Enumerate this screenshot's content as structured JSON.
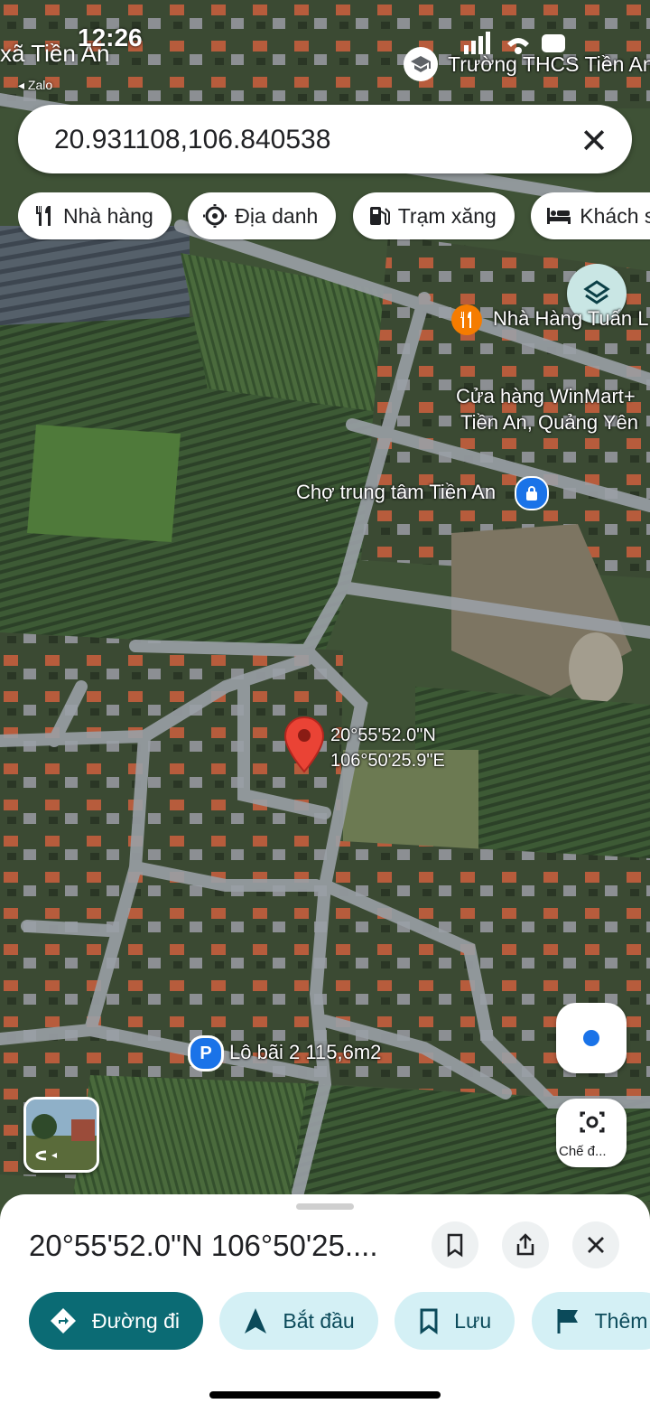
{
  "status_bar": {
    "time": "12:26",
    "back_app_label": "xã Tiền An",
    "back_app_name": "Zalo"
  },
  "search": {
    "query": "20.931108,106.840538"
  },
  "chips": [
    {
      "icon": "fork-knife-icon",
      "label": "Nhà hàng"
    },
    {
      "icon": "landmark-icon",
      "label": "Địa danh"
    },
    {
      "icon": "gas-pump-icon",
      "label": "Trạm xăng"
    },
    {
      "icon": "bed-icon",
      "label": "Khách sạn"
    }
  ],
  "map": {
    "labels": {
      "school": "Trường THCS Tiền An",
      "restaurant": "Nhà Hàng Tuấn L",
      "store_line1": "Cửa hàng WinMart+",
      "store_line2": "Tiền An, Quảng Yên",
      "market": "Chợ trung tâm Tiền An",
      "parking": "Lô bãi 2 115,6m2"
    },
    "pin": {
      "lat_text": "20°55'52.0\"N",
      "lng_text": "106°50'25.9\"E",
      "color": "#ea4335"
    },
    "camera_label": "Chế đ..."
  },
  "sheet": {
    "title": "20°55'52.0\"N 106°50'25....",
    "actions": [
      {
        "icon": "directions-icon",
        "label": "Đường đi"
      },
      {
        "icon": "navigation-arrow-icon",
        "label": "Bắt đầu"
      },
      {
        "icon": "bookmark-icon",
        "label": "Lưu"
      },
      {
        "icon": "flag-icon",
        "label": "Thêm"
      }
    ]
  },
  "colors": {
    "primary": "#0b6b74",
    "chip_bg": "#d4f0f5",
    "accent_blue": "#1a73e8"
  }
}
